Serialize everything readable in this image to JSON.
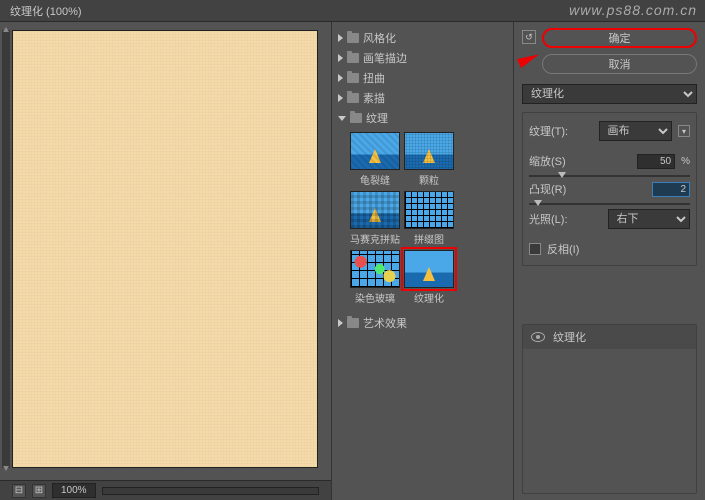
{
  "watermark": "www.ps88.com.cn",
  "title": "纹理化 (100%)",
  "zoom": {
    "minus": "⊟",
    "plus": "⊞",
    "value": "100%"
  },
  "folders": {
    "fenge": "风格化",
    "huabi": "画笔描边",
    "niuqu": "扭曲",
    "sumiao": "素描",
    "wenli": "纹理",
    "yishu": "艺术效果"
  },
  "thumbs": {
    "guiliefeng": "龟裂缝",
    "keli": "颗粒",
    "masaike": "马赛克拼贴",
    "pinzhui": "拼缀图",
    "ranse": "染色玻璃",
    "wenlihua": "纹理化"
  },
  "buttons": {
    "ok": "确定",
    "cancel": "取消"
  },
  "dropdown": {
    "main": "纹理化"
  },
  "params": {
    "texture_label": "纹理(T):",
    "texture_value": "画布",
    "scale_label": "缩放(S)",
    "scale_value": "50",
    "relief_label": "凸现(R)",
    "relief_value": "2",
    "light_label": "光照(L):",
    "light_value": "右下",
    "invert": "反相(I)",
    "pct": "%"
  },
  "layer": {
    "name": "纹理化"
  },
  "reset": "↺"
}
